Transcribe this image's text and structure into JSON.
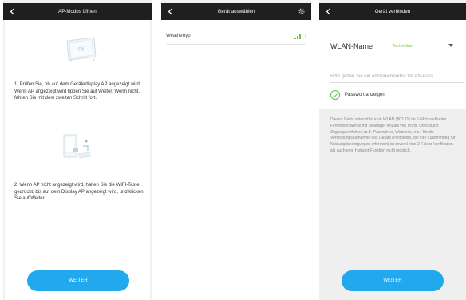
{
  "screen1": {
    "title": "AP-Modus öffnen",
    "illustration1_label": "Rf",
    "step1": "1. Prüfen Sie, ob au\" dem Gerätedisplay AP angezeigt wird. Wenn AP angezeigt wird tippen Sie auf Weiter. Wenn nicht, fahren Sie mit dem zweiten Schritt fort.",
    "step2": "2. Wenn AP nicht angezeigt wird, halten Sie die WIFI-Taste gedrückt, bis auf dem Display AP angezeigt wird, und klicken Sie auf Weiter.",
    "next_label": "WEITER"
  },
  "screen2": {
    "title": "Gerät auswählen",
    "device_name": "Weathertyp",
    "chevron": "›"
  },
  "screen3": {
    "title": "Gerät verbinden",
    "wlan_label": "WLAN-Name",
    "wlan_value": "Technicline",
    "password_placeholder": "Bitte geben Sie ein entsprechendes WLAN-Pass",
    "show_password_label": "Passwort anzeigen",
    "note": "Dieses Gerät unterstützt kein WLAN (802.11) im 5 GHz und keine Firmennetzwerke mit beliebiger Anzahl von Ports. Unterstützt Zugangsverfahren (z.B. Passwörter, Webseite, etc.) für die Verbindungsaufnahme des Geräts (Protokolle, die ihre Zustimmung für Nutzungsbedingungen erfordern) ist sowohl eine 2-Faktor-Verifikation als auch eine Hotspot-Funktion nicht möglich.",
    "next_label": "WEITER"
  },
  "colors": {
    "topbar": "#1f1f1f",
    "accent": "#22a8ec",
    "wifi_green": "#7bc043",
    "check_green": "#5cb85c"
  },
  "icons": [
    "back-arrow-icon",
    "gear-icon",
    "wifi-signal-icon",
    "chevron-right-icon",
    "check-circle-icon",
    "dropdown-arrow-icon"
  ]
}
